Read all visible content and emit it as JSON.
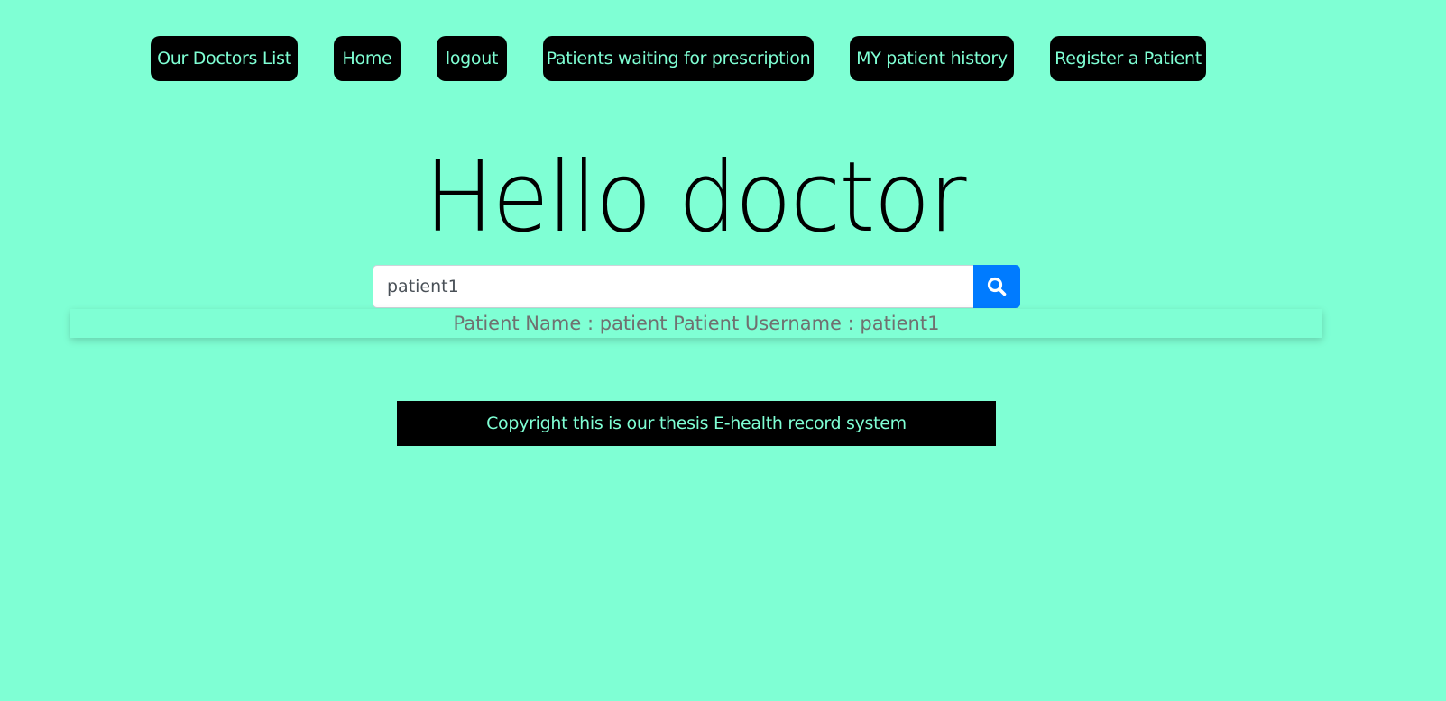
{
  "nav": {
    "doctors_list": "Our Doctors List",
    "home": "Home",
    "logout": "logout",
    "waiting_prescription": "Patients waiting for prescription",
    "patient_history": "MY patient history",
    "register_patient": "Register a Patient"
  },
  "greeting": "Hello doctor",
  "search": {
    "value": "patient1",
    "icon": "search-icon",
    "button_color": "#007bff"
  },
  "results": [
    {
      "text": "Patient Name : patient Patient Username : patient1"
    }
  ],
  "footer": {
    "text": "Copyright this is our thesis E-health record system"
  },
  "colors": {
    "background": "#7fffd4",
    "nav_background": "#000000",
    "nav_text": "#7fffd4"
  }
}
